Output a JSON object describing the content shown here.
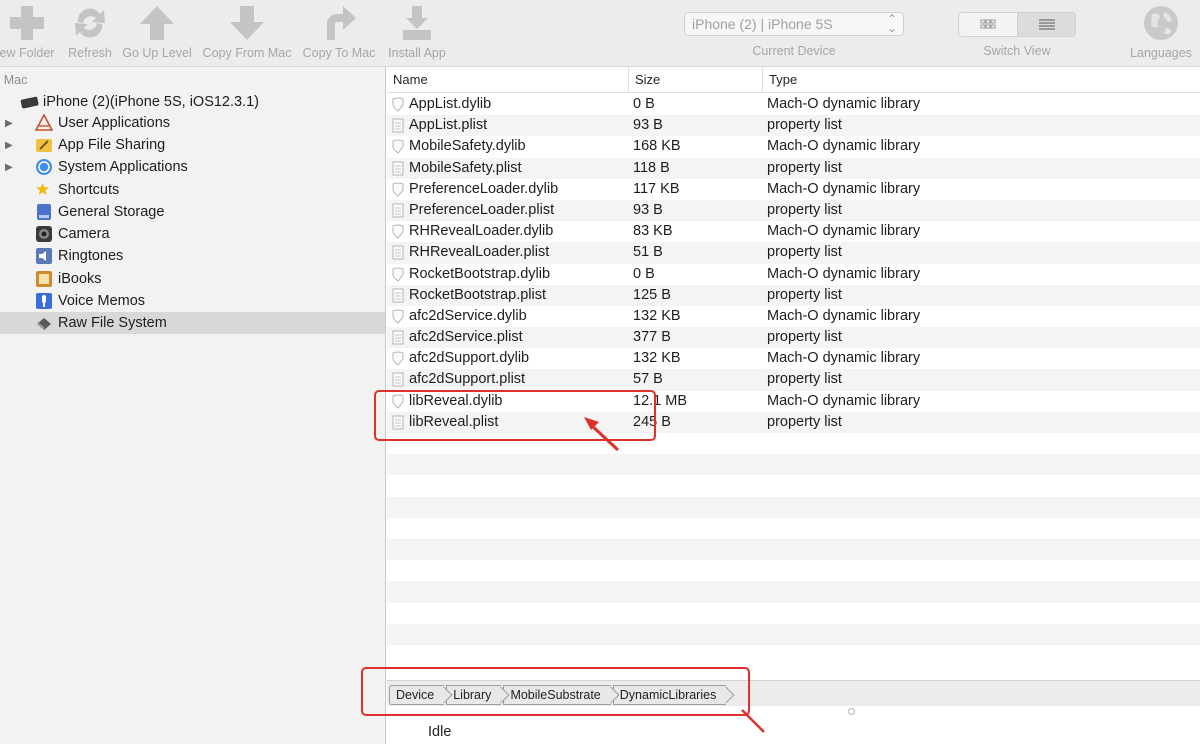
{
  "toolbar": {
    "new_folder": "ew Folder",
    "refresh": "Refresh",
    "go_up_level": "Go Up Level",
    "copy_from_mac": "Copy From Mac",
    "copy_to_mac": "Copy To Mac",
    "install_app": "Install App",
    "device_select_value": "iPhone (2) | iPhone 5S",
    "device_select_label": "Current Device",
    "switch_view_label": "Switch View",
    "languages_label": "Languages"
  },
  "sidebar": {
    "header": "y Mac",
    "device": "iPhone (2)(iPhone 5S, iOS12.3.1)",
    "items": [
      {
        "label": "User Applications",
        "icon": "apps-icon",
        "expandable": true
      },
      {
        "label": "App File Sharing",
        "icon": "app-file-sharing-icon",
        "expandable": true
      },
      {
        "label": "System Applications",
        "icon": "app-store-icon",
        "expandable": true
      },
      {
        "label": "Shortcuts",
        "icon": "star-icon",
        "expandable": false
      },
      {
        "label": "General Storage",
        "icon": "storage-icon",
        "expandable": false
      },
      {
        "label": "Camera",
        "icon": "camera-icon",
        "expandable": false
      },
      {
        "label": "Ringtones",
        "icon": "speaker-icon",
        "expandable": false
      },
      {
        "label": "iBooks",
        "icon": "book-icon",
        "expandable": false
      },
      {
        "label": "Voice Memos",
        "icon": "microphone-icon",
        "expandable": false
      },
      {
        "label": "Raw File System",
        "icon": "filesystem-icon",
        "expandable": false,
        "selected": true
      }
    ]
  },
  "table": {
    "columns": [
      "Name",
      "Size",
      "Type"
    ],
    "rows": [
      {
        "name": "AppList.dylib",
        "size": "0 B",
        "type": "Mach-O dynamic library",
        "kind": "dylib"
      },
      {
        "name": "AppList.plist",
        "size": "93 B",
        "type": "property list",
        "kind": "plist"
      },
      {
        "name": "MobileSafety.dylib",
        "size": "168 KB",
        "type": "Mach-O dynamic library",
        "kind": "dylib"
      },
      {
        "name": "MobileSafety.plist",
        "size": "118 B",
        "type": "property list",
        "kind": "plist"
      },
      {
        "name": "PreferenceLoader.dylib",
        "size": "117 KB",
        "type": "Mach-O dynamic library",
        "kind": "dylib"
      },
      {
        "name": "PreferenceLoader.plist",
        "size": "93 B",
        "type": "property list",
        "kind": "plist"
      },
      {
        "name": "RHRevealLoader.dylib",
        "size": "83 KB",
        "type": "Mach-O dynamic library",
        "kind": "dylib"
      },
      {
        "name": "RHRevealLoader.plist",
        "size": "51 B",
        "type": "property list",
        "kind": "plist"
      },
      {
        "name": "RocketBootstrap.dylib",
        "size": "0 B",
        "type": "Mach-O dynamic library",
        "kind": "dylib"
      },
      {
        "name": "RocketBootstrap.plist",
        "size": "125 B",
        "type": "property list",
        "kind": "plist"
      },
      {
        "name": "afc2dService.dylib",
        "size": "132 KB",
        "type": "Mach-O dynamic library",
        "kind": "dylib"
      },
      {
        "name": "afc2dService.plist",
        "size": "377 B",
        "type": "property list",
        "kind": "plist"
      },
      {
        "name": "afc2dSupport.dylib",
        "size": "132 KB",
        "type": "Mach-O dynamic library",
        "kind": "dylib"
      },
      {
        "name": "afc2dSupport.plist",
        "size": "57 B",
        "type": "property list",
        "kind": "plist"
      },
      {
        "name": "libReveal.dylib",
        "size": "12.1 MB",
        "type": "Mach-O dynamic library",
        "kind": "dylib"
      },
      {
        "name": "libReveal.plist",
        "size": "245 B",
        "type": "property list",
        "kind": "plist"
      }
    ]
  },
  "pathbar": {
    "crumbs": [
      "Device",
      "Library",
      "MobileSubstrate",
      "DynamicLibraries"
    ]
  },
  "status": "Idle",
  "colors": {
    "annotation": "#e0302a",
    "selection": "#d8d8d8",
    "stripe": "#f4f4f4"
  }
}
